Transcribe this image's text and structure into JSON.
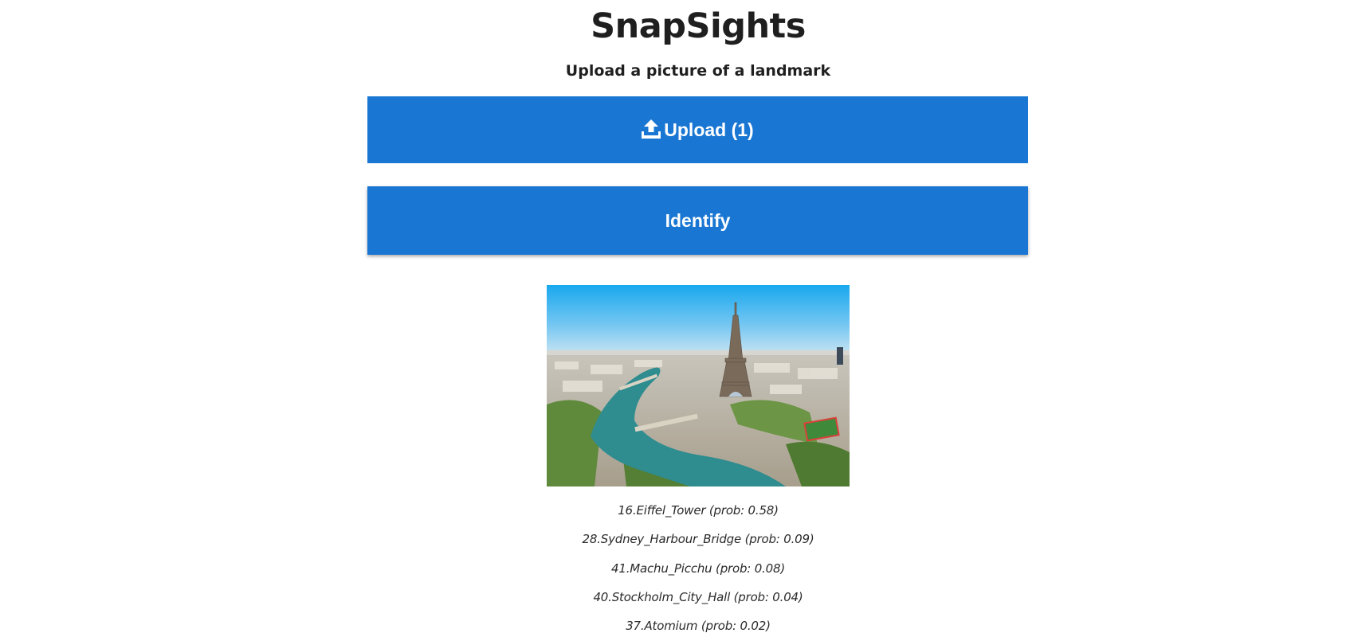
{
  "header": {
    "title": "SnapSights",
    "subtitle": "Upload a picture of a landmark"
  },
  "actions": {
    "upload_label": "Upload (1)",
    "upload_icon": "upload-icon",
    "identify_label": "Identify",
    "button_color": "#1976d2"
  },
  "preview": {
    "description_icon": "landmark-photo"
  },
  "results": [
    "16.Eiffel_Tower (prob: 0.58)",
    "28.Sydney_Harbour_Bridge (prob: 0.09)",
    "41.Machu_Picchu (prob: 0.08)",
    "40.Stockholm_City_Hall (prob: 0.04)",
    "37.Atomium (prob: 0.02)"
  ]
}
